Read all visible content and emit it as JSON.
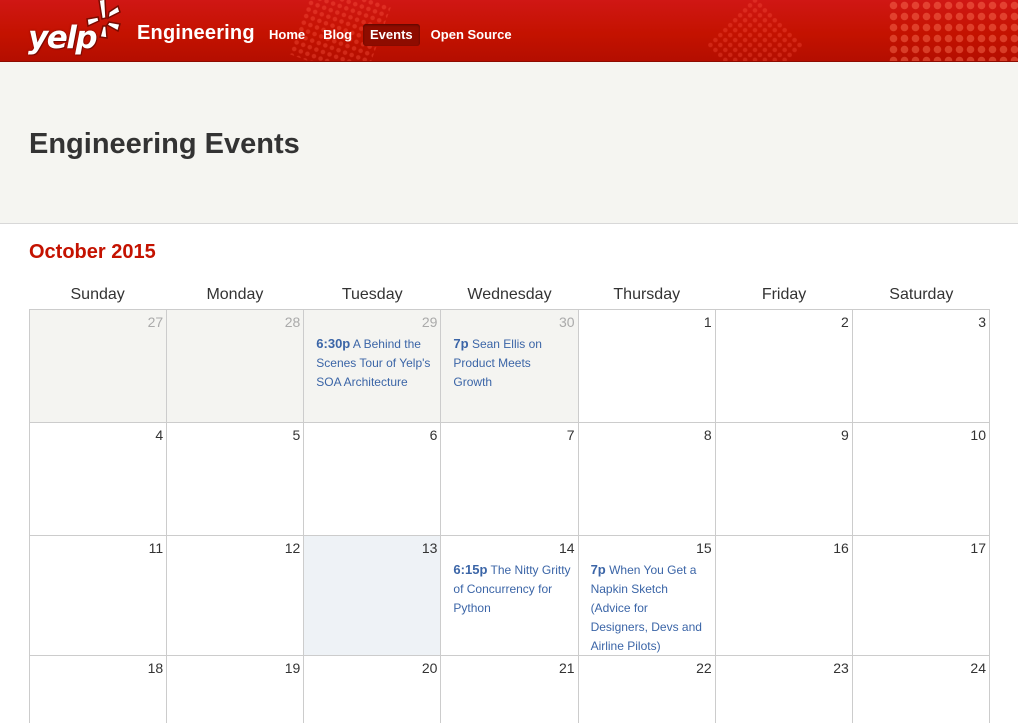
{
  "header": {
    "logo_text": "yelp",
    "site_name": "Engineering",
    "nav": [
      {
        "label": "Home",
        "active": false
      },
      {
        "label": "Blog",
        "active": false
      },
      {
        "label": "Events",
        "active": true
      },
      {
        "label": "Open Source",
        "active": false
      }
    ],
    "brand_color": "#c41200"
  },
  "hero": {
    "title": "Engineering Events"
  },
  "calendar": {
    "month": "October 2015",
    "weekdays": [
      "Sunday",
      "Monday",
      "Tuesday",
      "Wednesday",
      "Thursday",
      "Friday",
      "Saturday"
    ],
    "weeks": [
      [
        {
          "day": "27",
          "out": true
        },
        {
          "day": "28",
          "out": true
        },
        {
          "day": "29",
          "out": true,
          "event": {
            "time": "6:30p",
            "title": "A Behind the Scenes Tour of Yelp's SOA Architecture"
          }
        },
        {
          "day": "30",
          "out": true,
          "event": {
            "time": "7p",
            "title": "Sean Ellis on Product Meets Growth"
          }
        },
        {
          "day": "1"
        },
        {
          "day": "2"
        },
        {
          "day": "3"
        }
      ],
      [
        {
          "day": "4"
        },
        {
          "day": "5"
        },
        {
          "day": "6"
        },
        {
          "day": "7"
        },
        {
          "day": "8"
        },
        {
          "day": "9"
        },
        {
          "day": "10"
        }
      ],
      [
        {
          "day": "11"
        },
        {
          "day": "12"
        },
        {
          "day": "13",
          "today": true
        },
        {
          "day": "14",
          "event": {
            "time": "6:15p",
            "title": "The Nitty Gritty of Concurrency for Python"
          }
        },
        {
          "day": "15",
          "event": {
            "time": "7p",
            "title": "When You Get a Napkin Sketch (Advice for Designers, Devs and Airline Pilots)"
          }
        },
        {
          "day": "16"
        },
        {
          "day": "17"
        }
      ],
      [
        {
          "day": "18"
        },
        {
          "day": "19"
        },
        {
          "day": "20"
        },
        {
          "day": "21"
        },
        {
          "day": "22"
        },
        {
          "day": "23"
        },
        {
          "day": "24"
        }
      ]
    ]
  }
}
